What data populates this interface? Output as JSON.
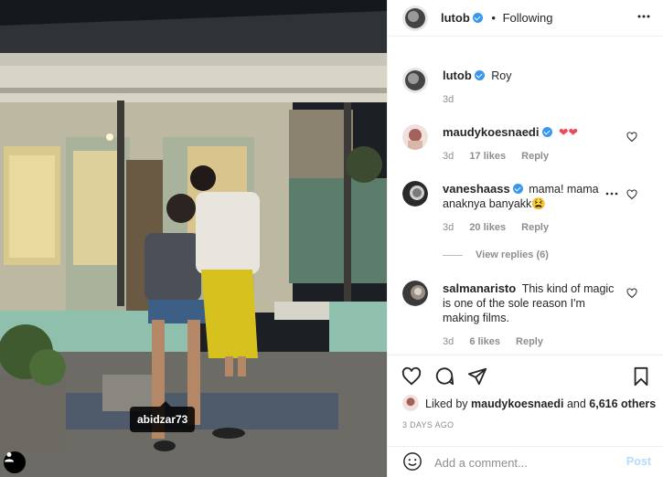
{
  "post": {
    "author": "lutob",
    "follow_status": "Following",
    "separator": "•",
    "caption": "Roy",
    "caption_time": "3d",
    "photo_tag": "abidzar73"
  },
  "comments": [
    {
      "user": "maudykoesnaedi",
      "verified": true,
      "text": "❤❤",
      "time": "3d",
      "likes": "17 likes",
      "reply": "Reply"
    },
    {
      "user": "vaneshaass",
      "verified": true,
      "text_line1": "mama! mama",
      "text_line2": "anaknya banyakk😫",
      "time": "3d",
      "likes": "20 likes",
      "reply": "Reply"
    },
    {
      "user": "salmanaristo",
      "verified": false,
      "text_line1": "This kind of magic",
      "text_line2": "is one of the sole reason I'm",
      "text_line3": "making films.",
      "time": "3d",
      "likes": "6 likes",
      "reply": "Reply"
    }
  ],
  "view_replies": "View replies (6)",
  "likes_line": {
    "prefix": "Liked by ",
    "user": "maudykoesnaedi",
    "mid": " and ",
    "count": "6,616 others"
  },
  "posted_ago": "3 DAYS AGO",
  "add_comment": {
    "placeholder": "Add a comment...",
    "post_label": "Post"
  },
  "colors": {
    "verified": "#3897f0",
    "heart": "#ed4956",
    "post_disabled": "#b3dbff",
    "muted": "#8e8e8e"
  }
}
